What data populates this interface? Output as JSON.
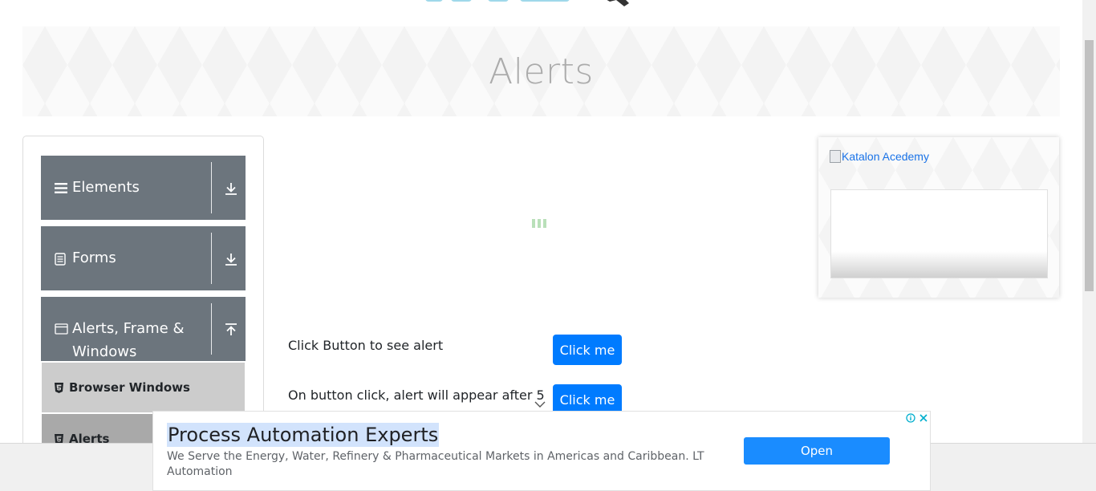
{
  "header": {
    "title": "Alerts"
  },
  "sidebar": {
    "groups": [
      {
        "label": "Elements",
        "icon": "hamburger-icon",
        "expanded": false
      },
      {
        "label": "Forms",
        "icon": "document-icon",
        "expanded": false
      },
      {
        "label": "Alerts, Frame &",
        "label_line2": "Windows",
        "icon": "window-icon",
        "expanded": true
      }
    ],
    "items": [
      {
        "label": "Browser Windows",
        "icon": "html5-icon",
        "active": false
      },
      {
        "label": "Alerts",
        "icon": "html5-icon",
        "active": true
      }
    ]
  },
  "main": {
    "rows": [
      {
        "label": "Click Button to see alert",
        "button": "Click me"
      },
      {
        "label": "On button click, alert will appear after 5",
        "button": "Click me"
      }
    ]
  },
  "side_ad": {
    "alt_text": "Katalon Acedemy"
  },
  "bottom_ad": {
    "title": "Process Automation Experts",
    "description": "We Serve the Energy, Water, Refinery & Pharmaceutical Markets in Americas and Caribbean. LT Automation",
    "open_label": "Open"
  },
  "colors": {
    "primary": "#007bff",
    "sidebar_group": "#6c757d",
    "sidebar_item": "#cccccc",
    "sidebar_item_active": "#a9a9a9",
    "ad_open": "#1a8cff"
  }
}
